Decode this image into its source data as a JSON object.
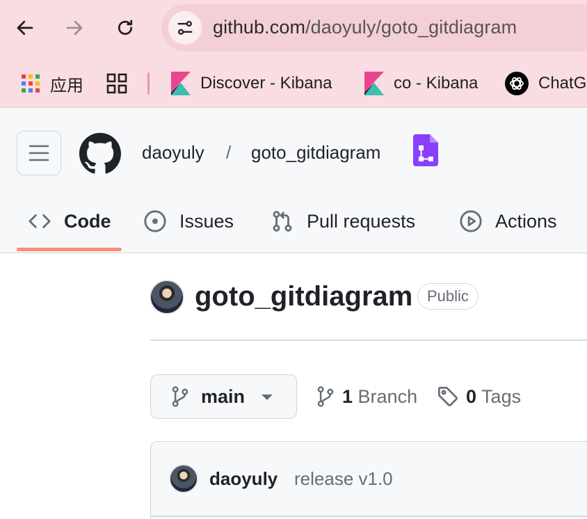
{
  "browser": {
    "url_host": "github.com",
    "url_path": "/daoyuly/goto_gitdiagram",
    "bookmarks": [
      {
        "label": "应用",
        "icon": "apps-grid-icon"
      },
      {
        "label": "",
        "icon": "tab-groups-icon"
      },
      {
        "label": "Discover - Kibana",
        "icon": "kibana-icon"
      },
      {
        "label": "co - Kibana",
        "icon": "kibana-icon"
      },
      {
        "label": "ChatG",
        "icon": "chatgpt-icon"
      }
    ]
  },
  "repo": {
    "owner": "daoyuly",
    "name": "goto_gitdiagram",
    "separator": "/",
    "title": "goto_gitdiagram",
    "visibility": "Public"
  },
  "tabs": [
    {
      "label": "Code",
      "icon": "code-icon",
      "active": true
    },
    {
      "label": "Issues",
      "icon": "issue-circle-icon",
      "active": false
    },
    {
      "label": "Pull requests",
      "icon": "pull-request-icon",
      "active": false
    },
    {
      "label": "Actions",
      "icon": "play-circle-icon",
      "active": false
    }
  ],
  "branch": {
    "current": "main",
    "branch_count": "1",
    "branch_label": "Branch",
    "tag_count": "0",
    "tag_label": "Tags"
  },
  "commit": {
    "author": "daoyuly",
    "message": "release v1.0"
  },
  "colors": {
    "chrome_bg": "#f9dde2",
    "tab_underline": "#fd8c73",
    "extension_purple": "#8a3ffc"
  }
}
